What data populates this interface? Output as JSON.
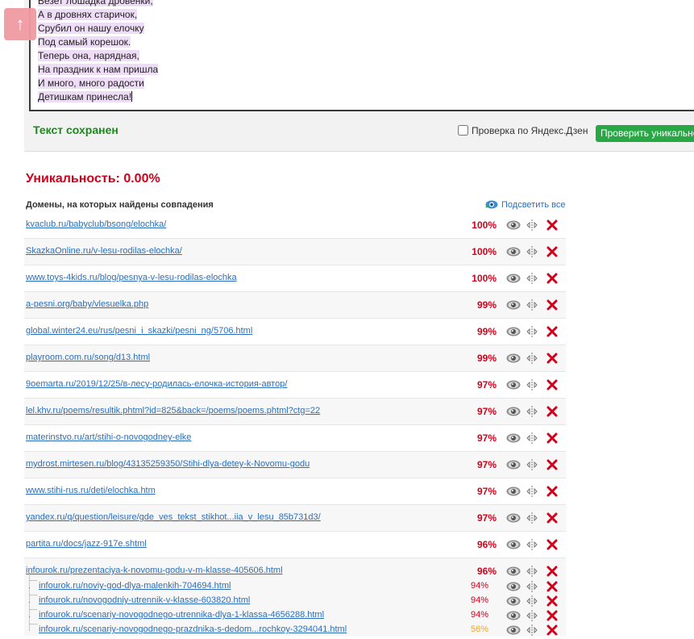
{
  "editor": {
    "lines": [
      {
        "text": "Везет лошадка дровенки,"
      },
      {
        "text": "А в дровнях старичок,"
      },
      {
        "text": "Срубил он нашу елочку"
      },
      {
        "text": "Под самый корешок."
      },
      {
        "text": "Теперь она, нарядная,"
      },
      {
        "text": "На праздник к нам пришла"
      },
      {
        "text": "И много, много радости"
      },
      {
        "text": "Детишкам принесла!"
      }
    ]
  },
  "status": {
    "saved": "Текст сохранен",
    "dzen_check_label": "Проверка по Яндекс.Дзен",
    "check_button": "Проверить уникальность"
  },
  "uniqueness": "Уникальность: 0.00%",
  "domains_header": "Домены, на которых найдены совпадения",
  "highlight_all": "Подсветить все",
  "colors": {
    "accent_red": "#d0021b",
    "link": "#2a6ebb",
    "saved_green": "#1a8a1a",
    "button_green": "#28a745",
    "orange": "#f5a623"
  },
  "results": [
    {
      "url": "kvaclub.ru/babyclub/bsong/elochka/",
      "pct": "100%"
    },
    {
      "url": "SkazkaOnline.ru/v-lesu-rodilas-elochka/",
      "pct": "100%"
    },
    {
      "url": "www.toys-4kids.ru/blog/pesnya-v-lesu-rodilas-elochka",
      "pct": "100%"
    },
    {
      "url": "a-pesni.org/baby/vlesuelka.php",
      "pct": "99%"
    },
    {
      "url": "global.winter24.eu/rus/pesni_i_skazki/pesni_ng/5706.html",
      "pct": "99%"
    },
    {
      "url": "playroom.com.ru/song/d13.html",
      "pct": "99%"
    },
    {
      "url": "9oemarta.ru/2019/12/25/в-лесу-родилась-елочка-история-автор/",
      "pct": "97%"
    },
    {
      "url": "lel.khv.ru/poems/resultik.phtml?id=825&back=/poems/poems.phtml?ctg=22",
      "pct": "97%"
    },
    {
      "url": "materinstvo.ru/art/stihi-o-novogodney-elke",
      "pct": "97%"
    },
    {
      "url": "mydrost.mirtesen.ru/blog/43135259350/Stihi-dlya-detey-k-Novomu-godu",
      "pct": "97%"
    },
    {
      "url": "www.stihi-rus.ru/deti/elochka.htm",
      "pct": "97%"
    },
    {
      "url": "yandex.ru/q/question/leisure/gde_ves_tekst_stikhot...iia_v_lesu_85b731d3/",
      "pct": "97%"
    },
    {
      "url": "partita.ru/docs/jazz-917e.shtml",
      "pct": "96%"
    }
  ],
  "group": {
    "url": "infourok.ru/prezentaciya-k-novomu-godu-v-m-klasse-405606.html",
    "pct": "96%",
    "children": [
      {
        "url": "infourok.ru/noviy-god-dlya-malenkih-704694.html",
        "pct": "94%"
      },
      {
        "url": "infourok.ru/novogodniy-utrennik-v-klasse-603820.html",
        "pct": "94%"
      },
      {
        "url": "infourok.ru/scenariy-novogodnego-utrennika-dlya-1-klassa-4656288.html",
        "pct": "94%"
      },
      {
        "url": "infourok.ru/scenariy-novogodnego-prazdnika-s-dedom...rochkoy-3294041.html",
        "pct": "56%"
      }
    ]
  }
}
